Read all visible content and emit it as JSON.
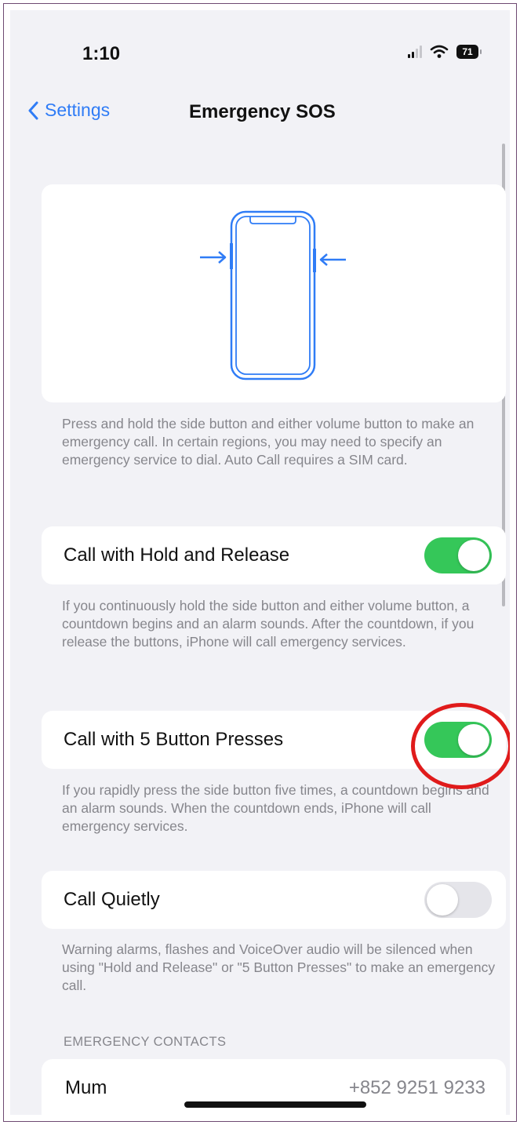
{
  "status_bar": {
    "time": "1:10",
    "battery_level": "71",
    "icons": [
      "signal-icon",
      "wifi-icon",
      "battery-icon"
    ]
  },
  "nav": {
    "back_label": "Settings",
    "title": "Emergency SOS"
  },
  "description": "Press and hold the side button and either volume button to make an emergency call. In certain regions, you may need to specify an emergency service to dial. Auto Call requires a SIM card.",
  "settings": [
    {
      "label": "Call with Hold and Release",
      "enabled": true,
      "footer": "If you continuously hold the side button and either volume button, a countdown begins and an alarm sounds. After the countdown, if you release the buttons, iPhone will call emergency services."
    },
    {
      "label": "Call with 5 Button Presses",
      "enabled": true,
      "footer": "If you rapidly press the side button five times, a countdown begins and an alarm sounds. When the countdown ends, iPhone will call emergency services."
    },
    {
      "label": "Call Quietly",
      "enabled": false,
      "footer": "Warning alarms, flashes and VoiceOver audio will be silenced when using \"Hold and Release\" or \"5 Button Presses\" to make an emergency call."
    }
  ],
  "emergency_contacts": {
    "header": "EMERGENCY CONTACTS",
    "contacts": [
      {
        "name": "Mum",
        "phone": "+852 9251 9233"
      }
    ]
  },
  "colors": {
    "accent": "#2f7cf6",
    "toggle_on": "#35c759",
    "toggle_off": "#e5e5ea",
    "highlight": "#e01b1b"
  }
}
